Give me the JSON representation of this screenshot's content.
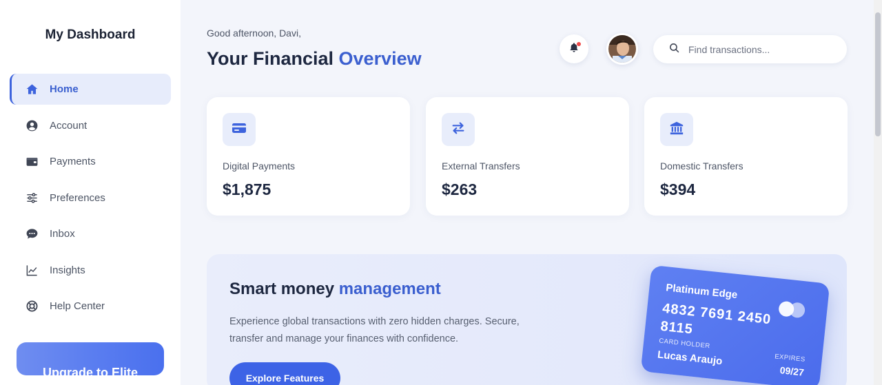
{
  "sidebar": {
    "brand": "My Dashboard",
    "items": [
      {
        "label": "Home",
        "icon": "home-icon",
        "active": true
      },
      {
        "label": "Account",
        "icon": "user-circle-icon",
        "active": false
      },
      {
        "label": "Payments",
        "icon": "wallet-icon",
        "active": false
      },
      {
        "label": "Preferences",
        "icon": "sliders-icon",
        "active": false
      },
      {
        "label": "Inbox",
        "icon": "chat-icon",
        "active": false
      },
      {
        "label": "Insights",
        "icon": "line-chart-icon",
        "active": false
      },
      {
        "label": "Help Center",
        "icon": "lifebuoy-icon",
        "active": false
      }
    ],
    "upgrade_label": "Upgrade to Elite"
  },
  "header": {
    "greeting": "Good afternoon, Davi,",
    "title_main": "Your Financial ",
    "title_accent": "Overview",
    "search_placeholder": "Find transactions...",
    "notification_dot": true
  },
  "stats": [
    {
      "label": "Digital Payments",
      "value": "$1,875",
      "icon": "credit-card-icon"
    },
    {
      "label": "External Transfers",
      "value": "$263",
      "icon": "transfer-arrows-icon"
    },
    {
      "label": "Domestic Transfers",
      "value": "$394",
      "icon": "bank-icon"
    }
  ],
  "promo": {
    "title_main": "Smart money ",
    "title_accent": "management",
    "description": "Experience global transactions with zero hidden charges. Secure, transfer and manage your finances with confidence.",
    "cta_label": "Explore Features"
  },
  "bank_card": {
    "name": "Platinum Edge",
    "number": "4832 7691 2450 8115",
    "holder_label": "CARD HOLDER",
    "holder": "Lucas Araujo",
    "expires_label": "EXPIRES",
    "expires": "09/27"
  },
  "colors": {
    "accent": "#3b5fcf",
    "primary_button": "#3d63e6",
    "background": "#f3f5fb",
    "notification": "#ef4b4b"
  }
}
